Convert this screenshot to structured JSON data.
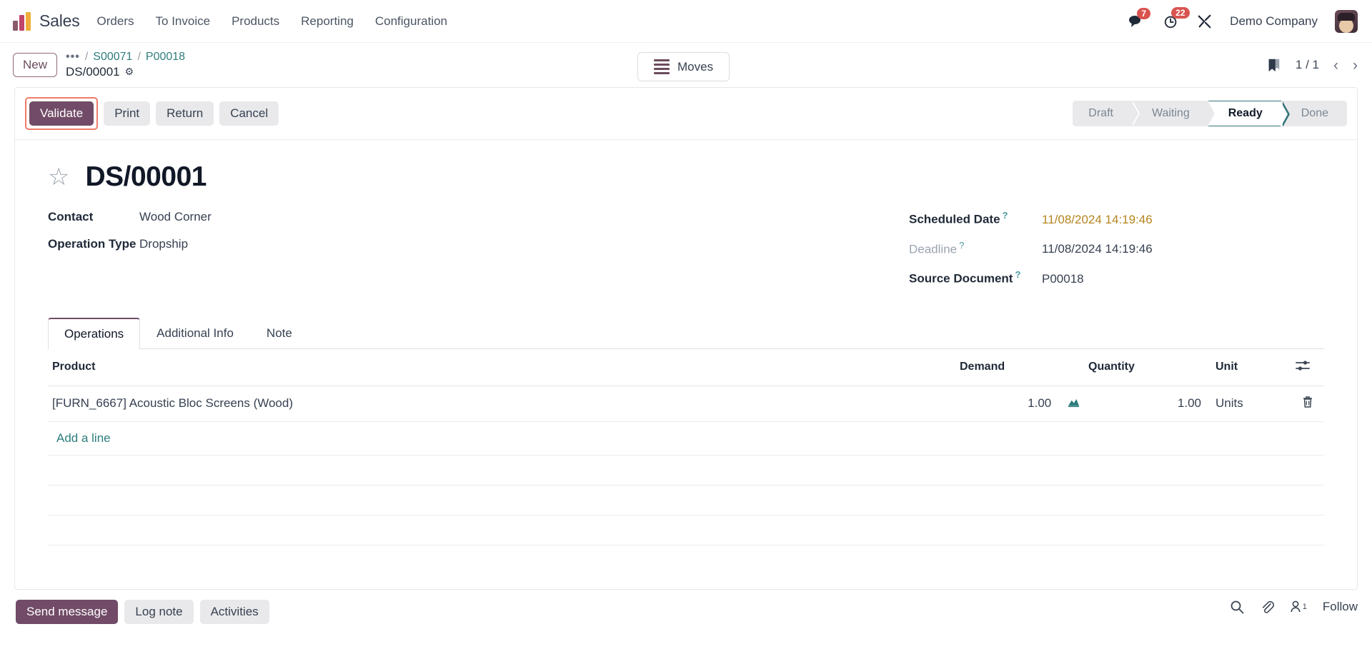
{
  "navbar": {
    "brand": "Sales",
    "menu": [
      "Orders",
      "To Invoice",
      "Products",
      "Reporting",
      "Configuration"
    ],
    "messages_badge": "7",
    "activities_badge": "22",
    "company": "Demo Company",
    "icons": {
      "messages": "messages-icon",
      "activities": "activity-clock-icon",
      "debug": "tools-icon",
      "avatar": "user-avatar"
    }
  },
  "breadcrumb": {
    "new_label": "New",
    "dots": "•••",
    "separator": "/",
    "link1": "S00071",
    "link2": "P00018",
    "current": "DS/00001",
    "gear": "⚙"
  },
  "smart_buttons": {
    "moves_label": "Moves"
  },
  "pager": {
    "count": "1 / 1",
    "prev": "‹",
    "next": "›"
  },
  "actions": {
    "validate": "Validate",
    "print": "Print",
    "return": "Return",
    "cancel": "Cancel"
  },
  "statusbar": {
    "states": [
      "Draft",
      "Waiting",
      "Ready",
      "Done"
    ],
    "active": "Ready"
  },
  "record": {
    "title": "DS/00001",
    "left_fields": [
      {
        "label": "Contact",
        "value": "Wood Corner"
      },
      {
        "label": "Operation Type",
        "value": "Dropship"
      }
    ],
    "right_fields": [
      {
        "label": "Scheduled Date",
        "value": "11/08/2024 14:19:46",
        "tooltip": "?"
      },
      {
        "label": "Deadline",
        "value": "11/08/2024 14:19:46",
        "tooltip": "?"
      },
      {
        "label": "Source Document",
        "value": "P00018",
        "tooltip": "?"
      }
    ]
  },
  "notebook": {
    "tabs": [
      "Operations",
      "Additional Info",
      "Note"
    ],
    "active_tab": "Operations"
  },
  "table": {
    "headers": [
      "Product",
      "Demand",
      "Quantity",
      "Unit"
    ],
    "rows": [
      {
        "product": "[FURN_6667] Acoustic Bloc Screens (Wood)",
        "demand": "1.00",
        "quantity": "1.00",
        "unit": "Units"
      }
    ],
    "add_line": "Add a line"
  },
  "chatter": {
    "send_message": "Send message",
    "log_note": "Log note",
    "activities": "Activities",
    "follower_count": "1",
    "follow": "Follow"
  },
  "colors": {
    "primary": "#714b67",
    "accent_teal": "#2e7d7d",
    "warning": "#b5851f",
    "badge_red": "#d9534f",
    "highlight": "#ef7b6a"
  }
}
